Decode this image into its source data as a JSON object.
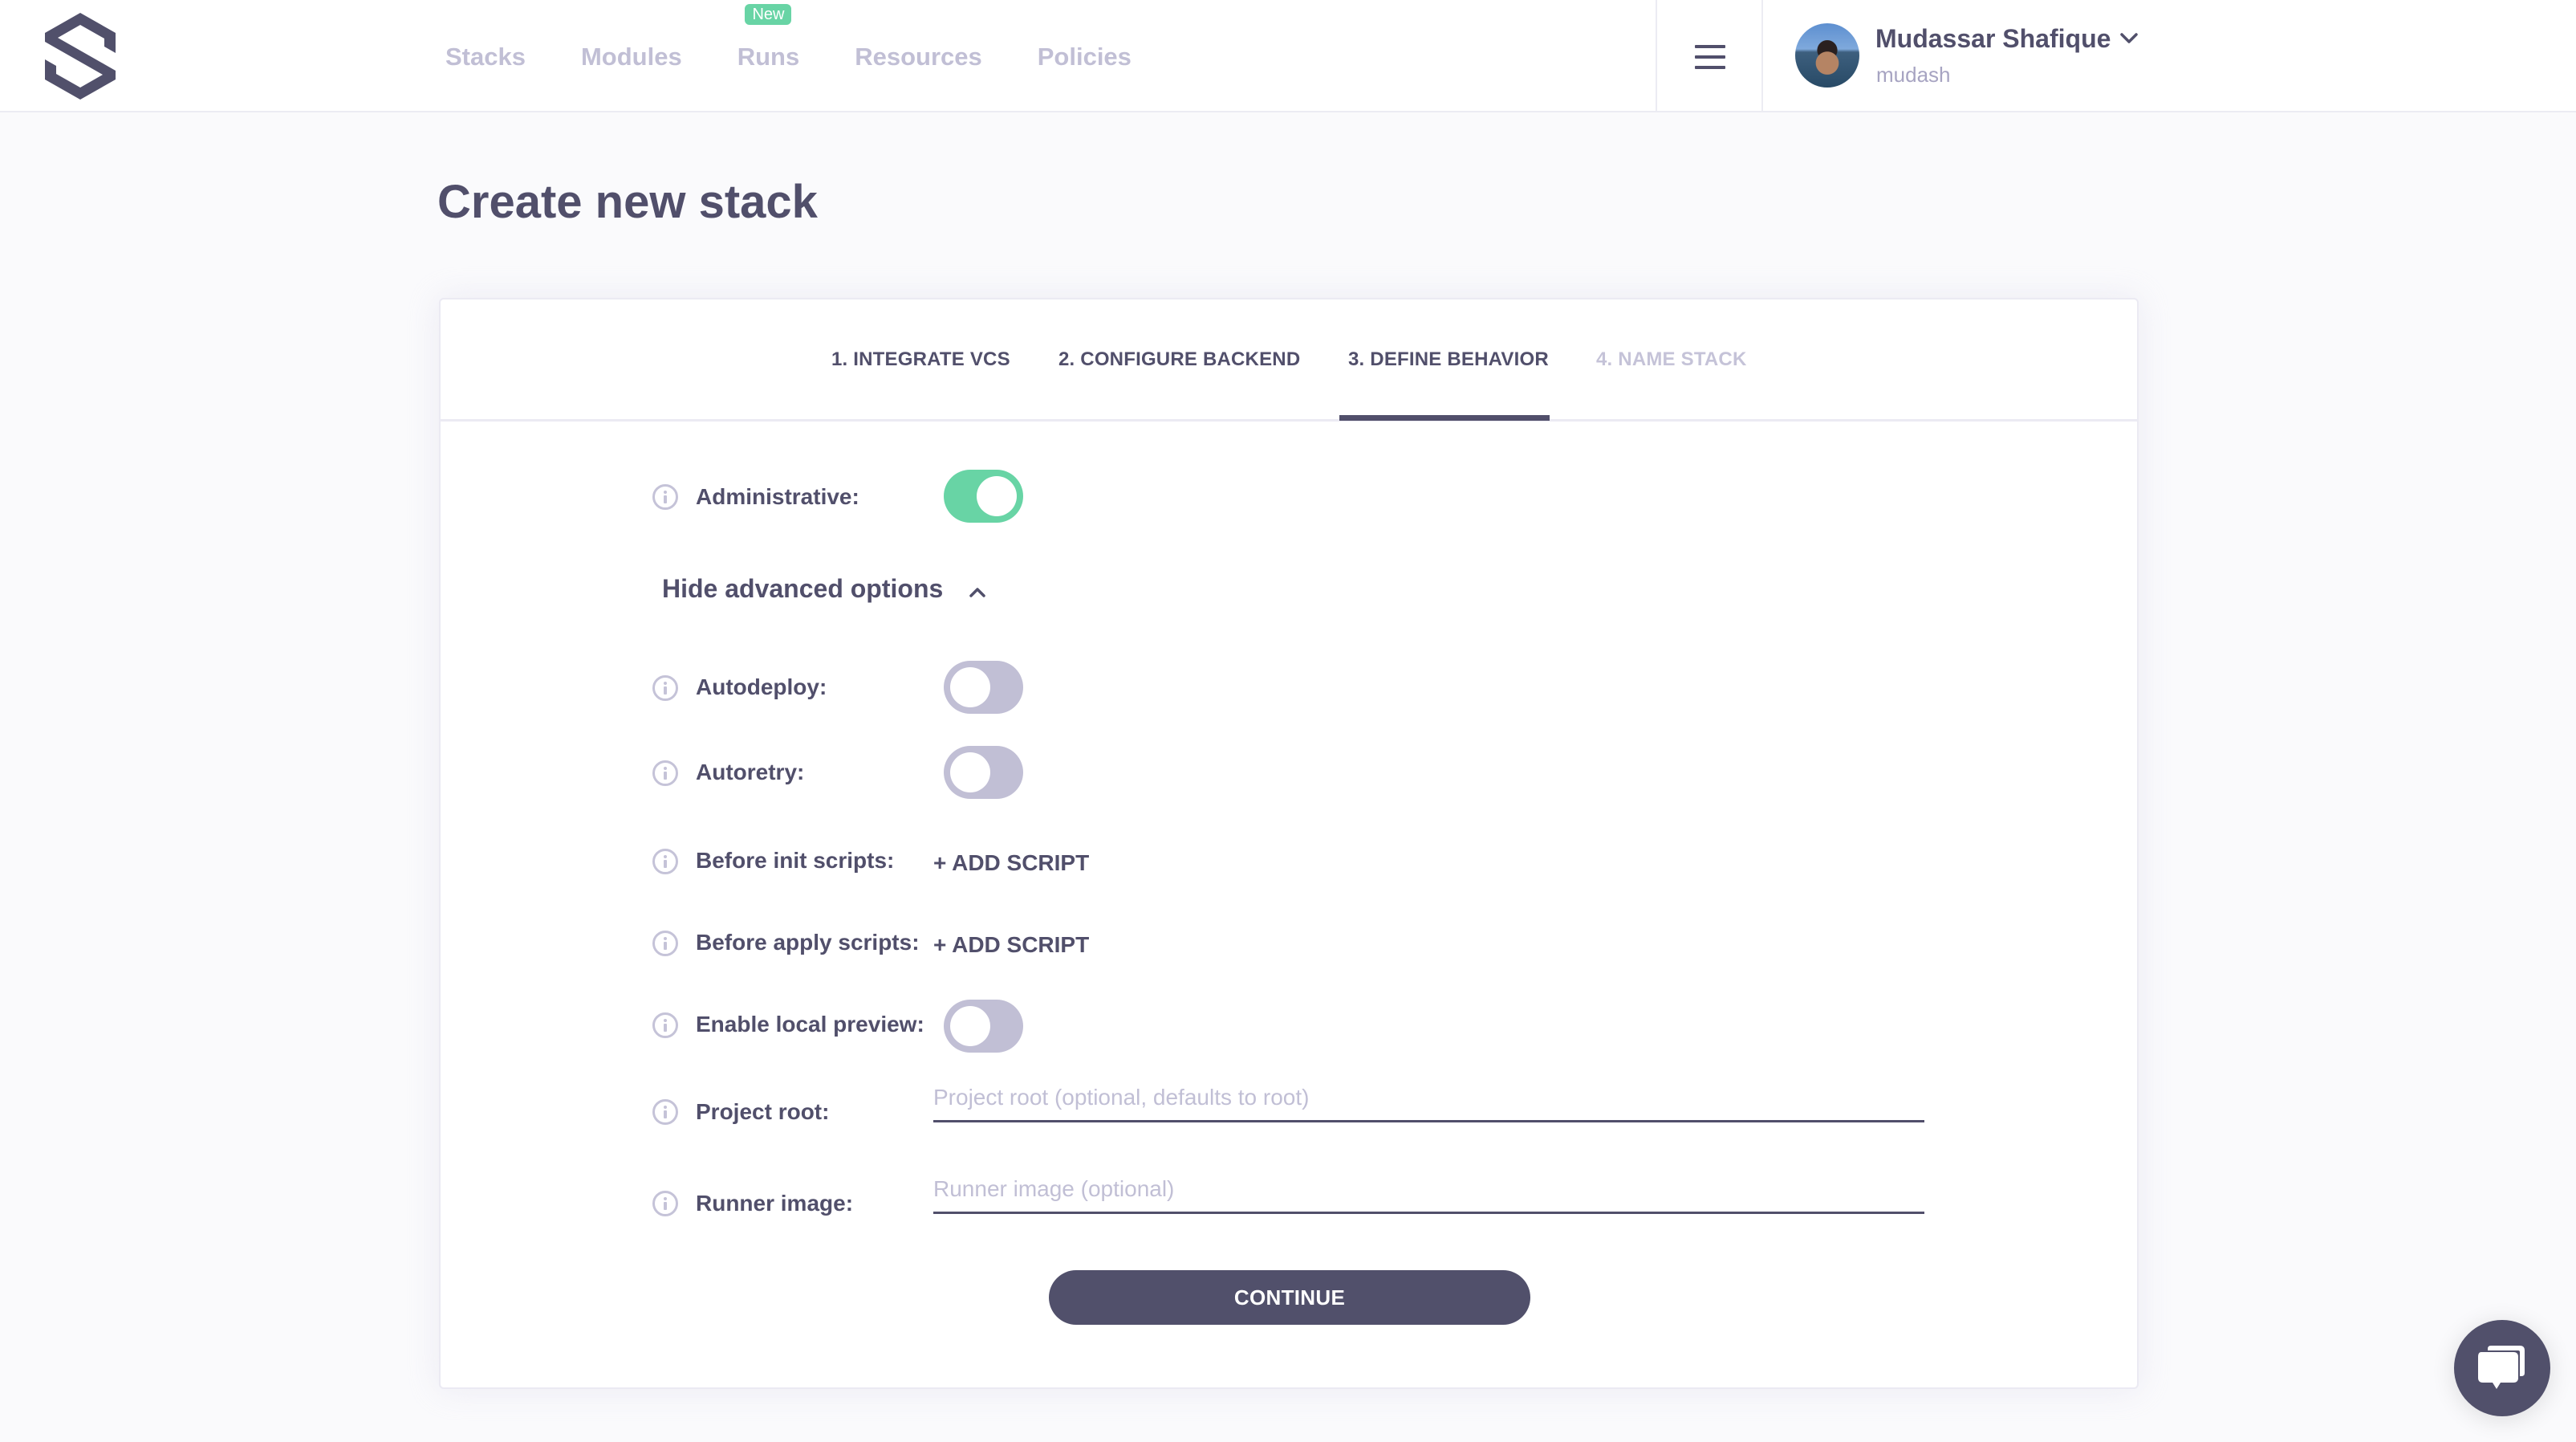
{
  "header": {
    "logo": "spacelift-logo",
    "nav": [
      {
        "label": "Stacks",
        "badge": null
      },
      {
        "label": "Modules",
        "badge": null
      },
      {
        "label": "Runs",
        "badge": "New"
      },
      {
        "label": "Resources",
        "badge": null
      },
      {
        "label": "Policies",
        "badge": null
      }
    ],
    "menu_icon": "hamburger-icon",
    "user": {
      "name": "Mudassar Shafique",
      "handle": "mudash",
      "avatar_icon": "user-avatar"
    }
  },
  "page": {
    "title": "Create new stack"
  },
  "wizard": {
    "steps": [
      {
        "label": "1. INTEGRATE VCS",
        "state": "completed"
      },
      {
        "label": "2. CONFIGURE BACKEND",
        "state": "completed"
      },
      {
        "label": "3. DEFINE BEHAVIOR",
        "state": "active"
      },
      {
        "label": "4. NAME STACK",
        "state": "disabled"
      }
    ]
  },
  "form": {
    "administrative": {
      "label": "Administrative:",
      "value": true
    },
    "advanced_toggle_label": "Hide advanced options",
    "autodeploy": {
      "label": "Autodeploy:",
      "value": false
    },
    "autoretry": {
      "label": "Autoretry:",
      "value": false
    },
    "before_init": {
      "label": "Before init scripts:",
      "action": "+ ADD SCRIPT"
    },
    "before_apply": {
      "label": "Before apply scripts:",
      "action": "+ ADD SCRIPT"
    },
    "local_preview": {
      "label": "Enable local preview:",
      "value": false
    },
    "project_root": {
      "label": "Project root:",
      "value": "",
      "placeholder": "Project root (optional, defaults to root)"
    },
    "runner_image": {
      "label": "Runner image:",
      "value": "",
      "placeholder": "Runner image (optional)"
    },
    "continue_label": "CONTINUE"
  },
  "colors": {
    "primary": "#51506b",
    "accent_green": "#68d4a5",
    "muted": "#c1bfd5",
    "background": "#fafafc"
  },
  "chat": {
    "icon": "chat-bubble-icon"
  }
}
